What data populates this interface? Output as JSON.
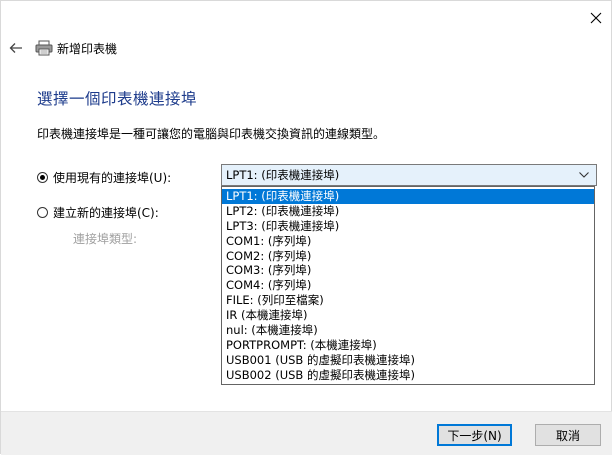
{
  "window": {
    "nav_title": "新增印表機",
    "heading": "選擇一個印表機連接埠",
    "description": "印表機連接埠是一種可讓您的電腦與印表機交換資訊的連線類型。"
  },
  "options": {
    "use_existing_label": "使用現有的連接埠(U):",
    "use_existing_checked": true,
    "create_new_label": "建立新的連接埠(C):",
    "create_new_checked": false,
    "port_type_label": "連接埠類型:"
  },
  "port_combo": {
    "selected": "LPT1: (印表機連接埠)",
    "items": [
      "LPT1: (印表機連接埠)",
      "LPT2: (印表機連接埠)",
      "LPT3: (印表機連接埠)",
      "COM1: (序列埠)",
      "COM2: (序列埠)",
      "COM3: (序列埠)",
      "COM4: (序列埠)",
      "FILE: (列印至檔案)",
      "IR (本機連接埠)",
      "nul: (本機連接埠)",
      "PORTPROMPT: (本機連接埠)",
      "USB001 (USB 的虛擬印表機連接埠)",
      "USB002 (USB 的虛擬印表機連接埠)"
    ]
  },
  "footer": {
    "next_label": "下一步(N)",
    "cancel_label": "取消"
  },
  "colors": {
    "heading": "#1e3c8c",
    "selection": "#0078d7",
    "combo_bg": "#e5f1fb"
  }
}
